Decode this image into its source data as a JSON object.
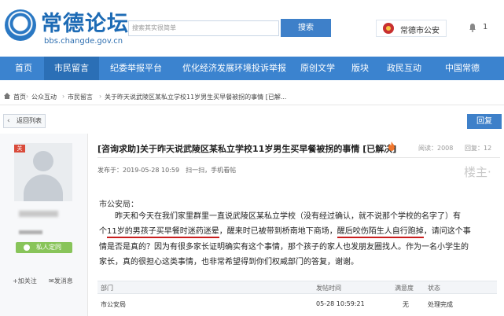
{
  "header": {
    "logo_text": "常德论坛",
    "logo_url": "bbs.changde.gov.cn",
    "search_placeholder": "搜索其实很简单",
    "search_button": "搜索",
    "police_label": "常德市公安",
    "notification_count": "1"
  },
  "nav": {
    "items": [
      "首页",
      "市民留言",
      "纪委举报平台",
      "优化经济发展环境投诉举报",
      "原创文学",
      "版块",
      "政民互动",
      "中国常德"
    ],
    "active": "市民留言"
  },
  "breadcrumb": {
    "items": [
      "首页",
      "公众互动",
      "市民留言",
      "关于昨天说武陵区某私立学校11岁男生买早餐被拐的事情 [已解..."
    ],
    "separator": "›"
  },
  "actions": {
    "back_label": "返回列表",
    "reply_label": "回复"
  },
  "user": {
    "badge": "关",
    "vip_label": "私人定同",
    "add_follow": "加关注",
    "send_message": "发消息"
  },
  "post": {
    "title": "[咨询求助]关于昨天说武陵区某私立学校11岁男生买早餐被拐的事情 [已解决]",
    "views_label": "阅读：2008",
    "replies_label": "回复：12",
    "meta": "发布于：2019-05-28 10:59　扫一扫，手机看帖",
    "floor_label": "楼主·",
    "salutation": "市公安局：",
    "line1": "　　昨天和今天在我们家里群里一直说武陵区某私立学校（没有经过确认，就不说那个学校的名字了）有",
    "line2_pre": "个",
    "line2_hl1": "11岁的男孩子买早餐时迷药迷晕",
    "line2_mid": "，醒来时已被带到桥南地下商场，",
    "line2_hl2": "醒后咬伤陌生人自行跑掉",
    "line2_post": "，请问这个事",
    "line3": "情是否是真的？因为有很多家长证明确实有这个事情，那个孩子的家人也发朋友圈找人。作为一名小学生的",
    "line4": "家长，真的很担心这类事情，也非常希望得到你们权威部门的答复，谢谢。"
  },
  "reply_table": {
    "headers": [
      "部门",
      "发帖时间",
      "满意度",
      "状态"
    ],
    "row": [
      "市公安局",
      "05-28 10:59:21",
      "无",
      "处理完成"
    ]
  },
  "colors": {
    "brand_blue": "#3b83cf",
    "highlight_red": "#c81e1e"
  }
}
